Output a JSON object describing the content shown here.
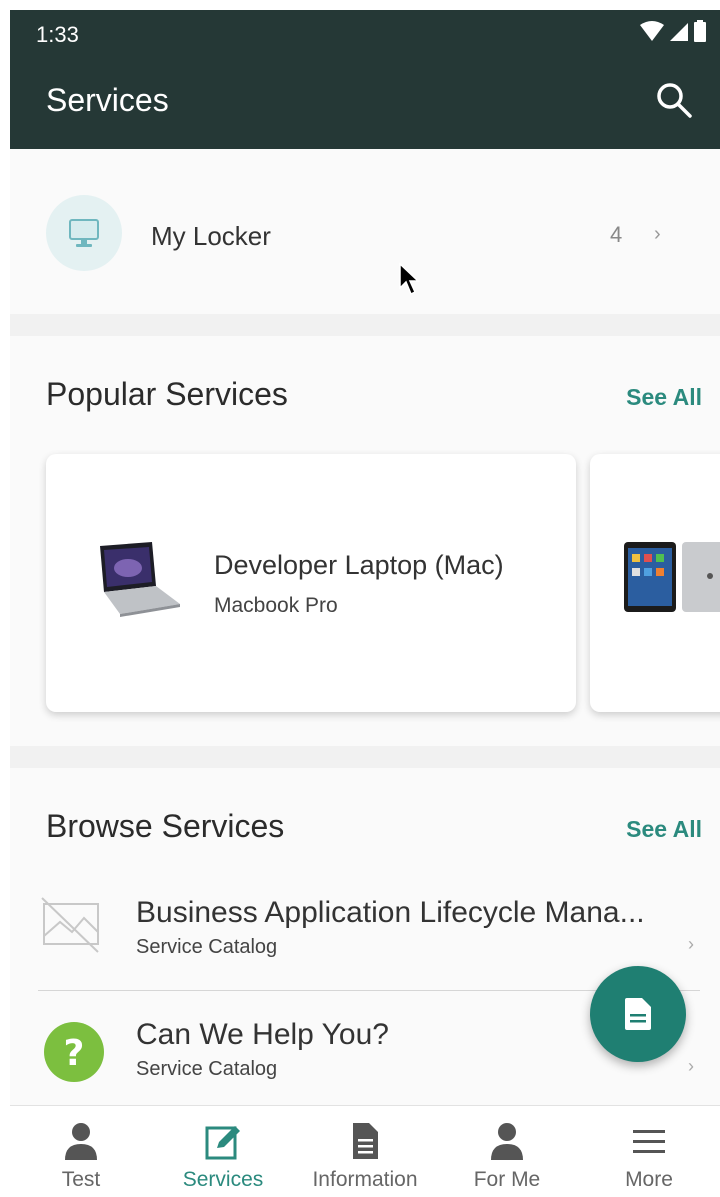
{
  "status": {
    "time": "1:33"
  },
  "appbar": {
    "title": "Services"
  },
  "locker": {
    "label": "My Locker",
    "count": "4"
  },
  "popular": {
    "title": "Popular Services",
    "see_all": "See All",
    "cards": [
      {
        "title": "Developer Laptop (Mac)",
        "subtitle": "Macbook Pro"
      }
    ]
  },
  "browse": {
    "title": "Browse Services",
    "see_all": "See All",
    "items": [
      {
        "title": "Business Application Lifecycle Mana...",
        "subtitle": "Service Catalog"
      },
      {
        "title": "Can We Help You?",
        "subtitle": "Service Catalog"
      }
    ]
  },
  "nav": {
    "items": [
      {
        "label": "Test",
        "icon": "person-icon"
      },
      {
        "label": "Services",
        "icon": "edit-icon"
      },
      {
        "label": "Information",
        "icon": "document-icon"
      },
      {
        "label": "For Me",
        "icon": "person-icon"
      },
      {
        "label": "More",
        "icon": "menu-icon"
      }
    ]
  },
  "colors": {
    "appbar": "#253836",
    "accent": "#2b8a7e",
    "fab": "#1f7f72",
    "help_green": "#7cbf3f"
  }
}
